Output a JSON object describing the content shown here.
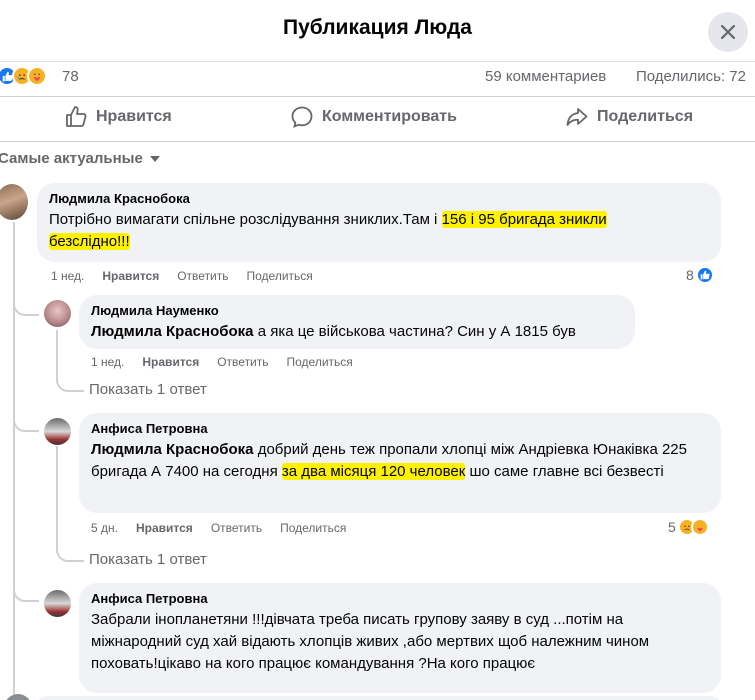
{
  "header": {
    "title": "Публикация Люда"
  },
  "stats": {
    "reaction_count": "78",
    "comments": "59 комментариев",
    "shares": "Поделились: 72"
  },
  "actions": {
    "like": "Нравится",
    "comment": "Комментировать",
    "share": "Поделиться"
  },
  "sort": {
    "label": "Самые актуальные"
  },
  "comments": [
    {
      "author": "Людмила Краснобока",
      "text_before": "Потрібно вимагати спільне розслідування зниклих.Там і ",
      "text_hl_line1": "156 і 95 бригада зникли",
      "text_hl_line2": "безслідно!!!",
      "time": "1 нед.",
      "like": "Нравится",
      "reply": "Ответить",
      "share": "Поделиться",
      "reaction_count": "8"
    },
    {
      "author": "Людмила Науменко",
      "mention": "Людмила Краснобока",
      "text": " а яка це військова частина? Син у А 1815 був",
      "time": "1 нед.",
      "like": "Нравится",
      "reply": "Ответить",
      "share": "Поделиться",
      "show_replies": "Показать 1 ответ"
    },
    {
      "author": "Анфиса Петровна",
      "mention": "Людмила Краснобока",
      "text_before": " добрий день теж пропали хлопці між Андріевка Юнаківка 225 бригада А 7400 на сегодня ",
      "text_hl": "за два місяця 120 человек",
      "text_after": " шо саме главне всі безвесті",
      "time": "5 дн.",
      "like": "Нравится",
      "reply": "Ответить",
      "share": "Поделиться",
      "reaction_count": "5",
      "show_replies": "Показать 1 ответ"
    },
    {
      "author": "Анфиса Петровна",
      "text": "Забрали інопланетяни !!!дівчата треба писать групову заяву в суд ...потім на міжнародний суд хай відають хлопців живих ,або мертвих щоб належним чином поховать!цікаво на кого працює командування ?На кого працює"
    }
  ],
  "icons": {
    "close": "close-icon",
    "like": "thumbs-up-icon",
    "comment": "comment-bubble-icon",
    "share": "share-arrow-icon",
    "sad": "sad-emoji-icon",
    "care": "care-emoji-icon"
  },
  "colors": {
    "accent": "#1877f2",
    "highlight": "#fff200",
    "bubble": "#f0f2f5",
    "muted": "#65676b"
  }
}
